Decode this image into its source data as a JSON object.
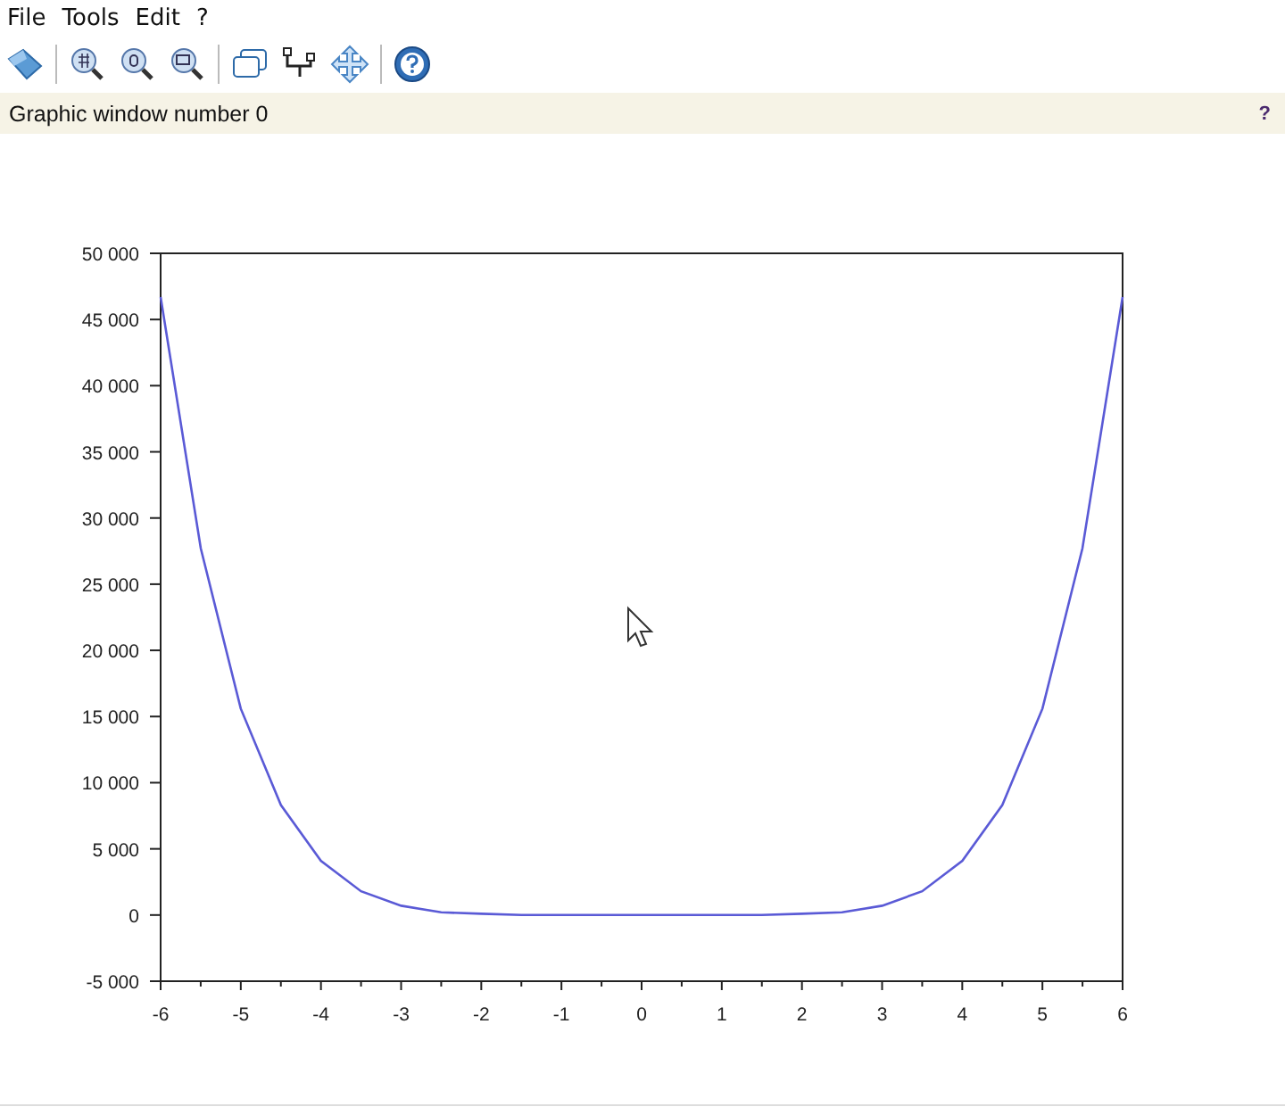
{
  "menu": [
    {
      "label": "File"
    },
    {
      "label": "Tools"
    },
    {
      "label": "Edit"
    },
    {
      "label": "?"
    }
  ],
  "info_bar": {
    "text": "Graphic window number 0",
    "help": "?"
  },
  "chart_data": {
    "type": "line",
    "x": [
      -6,
      -5.5,
      -5,
      -4.5,
      -4,
      -3.5,
      -3,
      -2.5,
      -2,
      -1.5,
      -1,
      -0.5,
      0,
      0.5,
      1,
      1.5,
      2,
      2.5,
      3,
      3.5,
      4,
      4.5,
      5,
      5.5,
      6
    ],
    "series": [
      {
        "color": "#5a5ad6",
        "values": [
          46700,
          27700,
          15600,
          8300,
          4100,
          1800,
          700,
          200,
          100,
          0,
          0,
          0,
          0,
          0,
          0,
          0,
          100,
          200,
          700,
          1800,
          4100,
          8300,
          15600,
          27700,
          46700
        ]
      }
    ],
    "xlim": [
      -6,
      6
    ],
    "ylim": [
      -5000,
      50000
    ],
    "xticks": [
      -6,
      -5,
      -4,
      -3,
      -2,
      -1,
      0,
      1,
      2,
      3,
      4,
      5,
      6
    ],
    "yticks": [
      {
        "value": -5000,
        "label": "-5 000"
      },
      {
        "value": 0,
        "label": "0"
      },
      {
        "value": 5000,
        "label": "5 000"
      },
      {
        "value": 10000,
        "label": "10 000"
      },
      {
        "value": 15000,
        "label": "15 000"
      },
      {
        "value": 20000,
        "label": "20 000"
      },
      {
        "value": 25000,
        "label": "25 000"
      },
      {
        "value": 30000,
        "label": "30 000"
      },
      {
        "value": 35000,
        "label": "35 000"
      },
      {
        "value": 40000,
        "label": "40 000"
      },
      {
        "value": 45000,
        "label": "45 000"
      },
      {
        "value": 50000,
        "label": "50 000"
      }
    ]
  }
}
